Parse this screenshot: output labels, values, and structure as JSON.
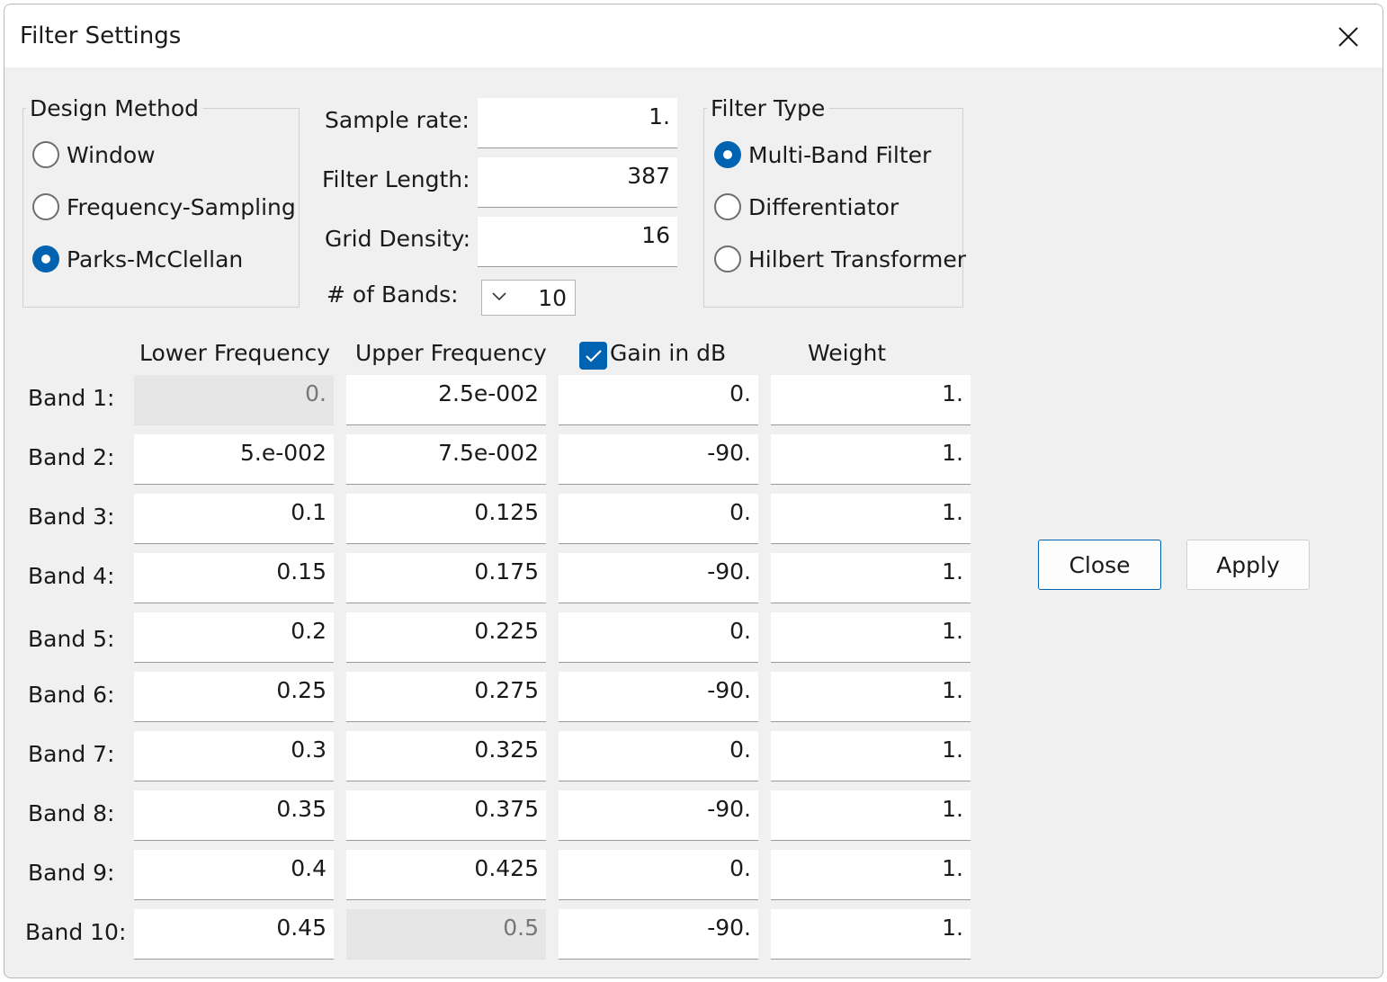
{
  "window": {
    "title": "Filter Settings",
    "close_icon": "close-icon"
  },
  "design_method": {
    "legend": "Design Method",
    "options": [
      {
        "label": "Window",
        "selected": false
      },
      {
        "label": "Frequency-Sampling",
        "selected": false
      },
      {
        "label": "Parks-McClellan",
        "selected": true
      }
    ]
  },
  "params": {
    "sample_rate_label": "Sample rate:",
    "sample_rate": "1.",
    "filter_length_label": "Filter Length:",
    "filter_length": "387",
    "grid_density_label": "Grid Density:",
    "grid_density": "16",
    "bands_label": "# of Bands:",
    "bands_value": "10"
  },
  "filter_type": {
    "legend": "Filter Type",
    "options": [
      {
        "label": "Multi-Band Filter",
        "selected": true
      },
      {
        "label": "Differentiator",
        "selected": false
      },
      {
        "label": "Hilbert Transformer",
        "selected": false
      }
    ]
  },
  "table": {
    "headers": {
      "lower": "Lower Frequency",
      "upper": "Upper Frequency",
      "gain": "Gain in dB",
      "weight": "Weight"
    },
    "gain_in_db_checked": true,
    "bands": [
      {
        "label": "Band 1:",
        "lower": "0.",
        "upper": "2.5e-002",
        "gain": "0.",
        "weight": "1."
      },
      {
        "label": "Band 2:",
        "lower": "5.e-002",
        "upper": "7.5e-002",
        "gain": "-90.",
        "weight": "1."
      },
      {
        "label": "Band 3:",
        "lower": "0.1",
        "upper": "0.125",
        "gain": "0.",
        "weight": "1."
      },
      {
        "label": "Band 4:",
        "lower": "0.15",
        "upper": "0.175",
        "gain": "-90.",
        "weight": "1."
      },
      {
        "label": "Band 5:",
        "lower": "0.2",
        "upper": "0.225",
        "gain": "0.",
        "weight": "1."
      },
      {
        "label": "Band 6:",
        "lower": "0.25",
        "upper": "0.275",
        "gain": "-90.",
        "weight": "1."
      },
      {
        "label": "Band 7:",
        "lower": "0.3",
        "upper": "0.325",
        "gain": "0.",
        "weight": "1."
      },
      {
        "label": "Band 8:",
        "lower": "0.35",
        "upper": "0.375",
        "gain": "-90.",
        "weight": "1."
      },
      {
        "label": "Band 9:",
        "lower": "0.4",
        "upper": "0.425",
        "gain": "0.",
        "weight": "1."
      },
      {
        "label": "Band 10:",
        "lower": "0.45",
        "upper": "0.5",
        "gain": "-90.",
        "weight": "1."
      }
    ]
  },
  "buttons": {
    "close": "Close",
    "apply": "Apply"
  },
  "colors": {
    "accent": "#0063b1",
    "window_bg": "#f0f0f0",
    "field_bg": "#ffffff",
    "disabled_field_bg": "#e6e6e6"
  }
}
